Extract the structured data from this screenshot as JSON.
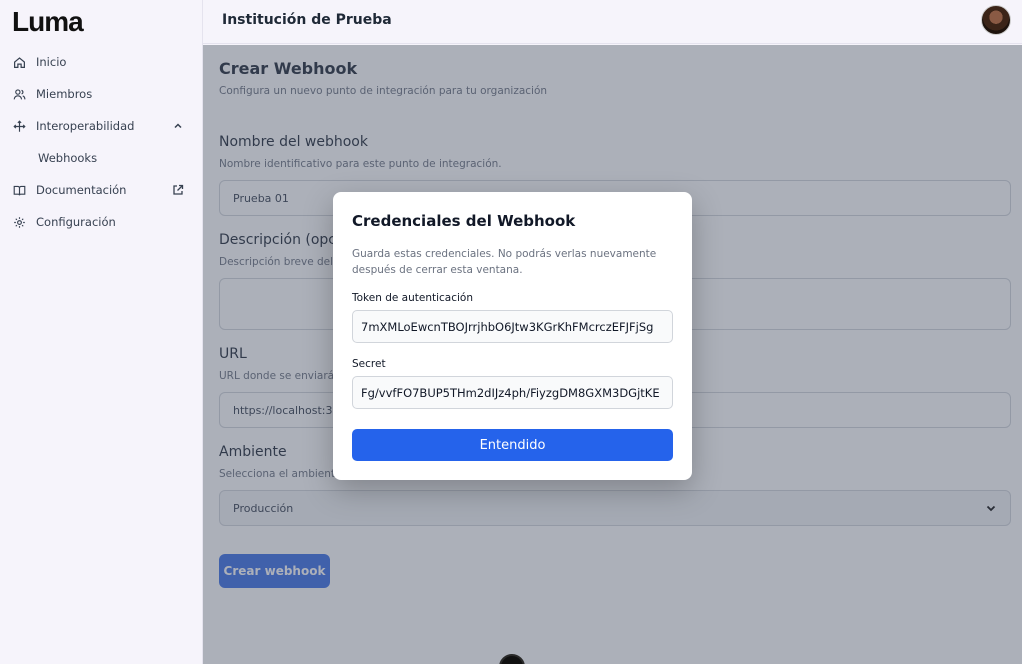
{
  "app": {
    "logo": "Luma"
  },
  "sidebar": {
    "items": [
      {
        "label": "Inicio",
        "icon": "home-icon"
      },
      {
        "label": "Miembros",
        "icon": "users-icon"
      },
      {
        "label": "Interoperabilidad",
        "icon": "arrows-icon",
        "expanded": true
      },
      {
        "label": "Webhooks"
      },
      {
        "label": "Documentación",
        "icon": "book-icon",
        "external": true
      },
      {
        "label": "Configuración",
        "icon": "gear-icon"
      }
    ]
  },
  "header": {
    "org_name": "Institución de Prueba"
  },
  "page": {
    "title": "Crear Webhook",
    "subtitle": "Configura un nuevo punto de integración para tu organización",
    "name_label": "Nombre del webhook",
    "name_help": "Nombre identificativo para este punto de integración.",
    "name_value": "Prueba 01",
    "desc_label": "Descripción (opcional)",
    "desc_help": "Descripción breve del propósito de este webhook.",
    "url_label": "URL",
    "url_help": "URL donde se enviarán los eventos.",
    "url_value": "https://localhost:3000",
    "env_label": "Ambiente",
    "env_help": "Selecciona el ambiente del webhook.",
    "env_value": "Producción",
    "create_button": "Crear webhook"
  },
  "modal": {
    "title": "Credenciales del Webhook",
    "description": "Guarda estas credenciales. No podrás verlas nuevamente después de cerrar esta ventana.",
    "token_label": "Token de autenticación",
    "token_value": "7mXMLoEwcnTBOJrrjhbO6Jtw3KGrKhFMcrczEFJFjSg",
    "secret_label": "Secret",
    "secret_value": "Fg/vvfFO7BUP5THm2dIJz4ph/FiyzgDM8GXM3DGjtKE",
    "ok_button": "Entendido"
  },
  "colors": {
    "primary": "#2563eb",
    "overlay": "#475064"
  }
}
